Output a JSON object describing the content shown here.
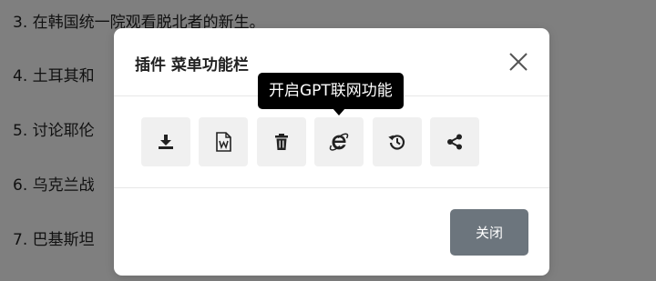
{
  "background_list": {
    "items": [
      "3. 在韩国统一院观看脱北者的新生。",
      "4. 土耳其和",
      "5. 讨论耶伦",
      "6. 乌克兰战",
      "7. 巴基斯坦",
      ""
    ]
  },
  "modal": {
    "title": "插件 菜单功能栏",
    "close_icon": "close-icon",
    "tools": [
      {
        "icon": "download-icon"
      },
      {
        "icon": "word-document-icon"
      },
      {
        "icon": "trash-icon"
      },
      {
        "icon": "internet-explorer-icon"
      },
      {
        "icon": "history-icon"
      },
      {
        "icon": "share-icon"
      }
    ],
    "footer": {
      "close_label": "关闭"
    }
  },
  "tooltip": {
    "text": "开启GPT联网功能"
  },
  "colors": {
    "overlay": "#000000",
    "button_secondary": "#6c757d",
    "tool_bg": "#f0f0f0",
    "tooltip_bg": "#000000"
  }
}
